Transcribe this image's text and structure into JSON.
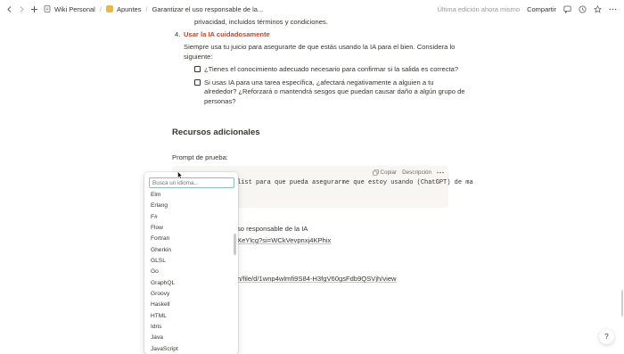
{
  "topbar": {
    "breadcrumb": [
      {
        "label": "Wiki Personal"
      },
      {
        "label": "Apuntes"
      },
      {
        "label": "Garantizar el uso responsable de la..."
      }
    ],
    "edit_status": "Última edición ahora mismo",
    "share_label": "Compartir"
  },
  "doc": {
    "line_privacidad": "privacidad, incluidos términos y condiciones.",
    "item4_number": "4.",
    "item4_title": "Usar la IA cuidadosamente",
    "para1_line1": "Siempre usa tu juicio para asegurarte de que estás usando la IA para el bien. Considera lo",
    "para1_line2": "siguiente:",
    "check1": "¿Tienes el conocimiento adecuado necesario para confirmar si la salida es correcta?",
    "check2_line1": "Si usas IA para una tarea específica, ¿afectará negativamente a alguien a tu",
    "check2_line2": "alrededor? ¿Reforzará o mantendrá sesgos que puedan causar daño a algún grupo de",
    "check2_line3": "personas?",
    "heading_recursos": "Recursos adicionales",
    "prompt_label": "Prompt de prueba:",
    "code_text": "list para que pueda asegurarme que estoy usando (ChatGPT) de ma",
    "code_copy": "Copiar",
    "code_desc": "Descripción",
    "partial_text1": "so responsable de la IA",
    "partial_link1": "XeYlcg?si=WCkVevpnxj4KPhix",
    "partial_link2": "n/file/d/1wnp4wlmfi9S84-H3fgV60gsFdb9QSVjh/view"
  },
  "language_dropdown": {
    "search_placeholder": "Busca un idioma...",
    "options": [
      "Elm",
      "Erlang",
      "F#",
      "Flow",
      "Fortran",
      "Gherkin",
      "GLSL",
      "Go",
      "GraphQL",
      "Groovy",
      "Haskell",
      "HTML",
      "Idris",
      "Java",
      "JavaScript"
    ]
  },
  "help_label": "?",
  "colors": {
    "accent_red": "#c4432f",
    "text": "#37352f",
    "muted": "#9b9a97"
  }
}
